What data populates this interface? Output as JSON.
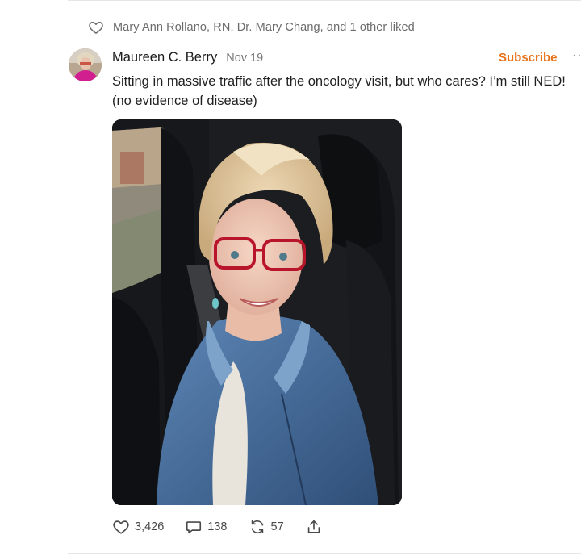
{
  "likes_summary": "Mary Ann Rollano, RN, Dr. Mary Chang, and 1 other liked",
  "post": {
    "author": "Maureen C. Berry",
    "date": "Nov 19",
    "text": "Sitting in massive traffic after the oncology visit, but who cares? I’m still NED! (no evidence of disease)",
    "subscribe_label": "Subscribe",
    "more_label": "···"
  },
  "actions": {
    "like_count": "3,426",
    "comment_count": "138",
    "restack_count": "57"
  },
  "icons": [
    "heart-icon",
    "comment-icon",
    "restack-icon",
    "share-icon",
    "more-icon"
  ],
  "colors": {
    "accent": "#e8731b",
    "muted": "#6b6b6b"
  }
}
